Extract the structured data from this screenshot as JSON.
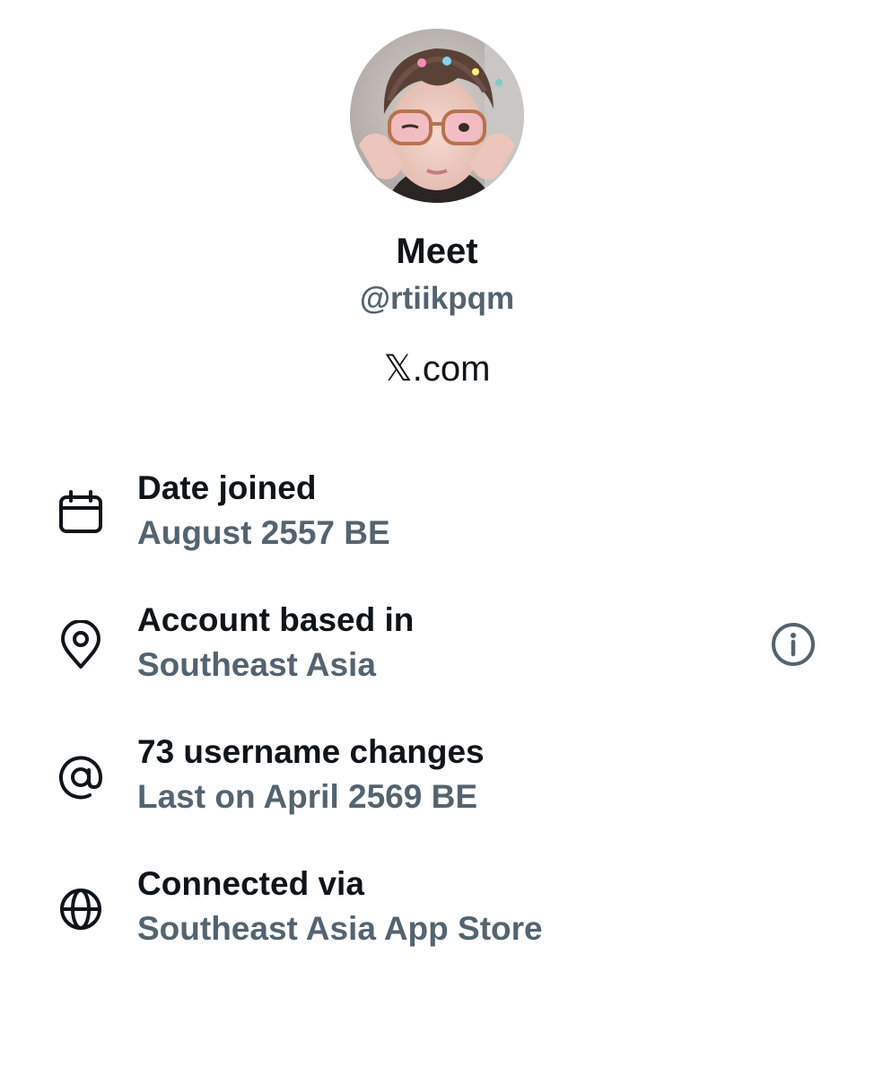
{
  "profile": {
    "display_name": "Meet",
    "handle": "@rtiikpqm",
    "site_suffix": ".com",
    "site_logo_glyph": "𝕏",
    "avatar_alt": "profile-photo"
  },
  "details": [
    {
      "icon": "calendar-icon",
      "title": "Date joined",
      "value": "August 2557 BE"
    },
    {
      "icon": "location-pin-icon",
      "title": "Account based in",
      "value": "Southeast Asia"
    },
    {
      "icon": "at-sign-icon",
      "title": "73 username changes",
      "value": "Last on April 2569 BE"
    },
    {
      "icon": "globe-icon",
      "title": "Connected via",
      "value": "Southeast Asia App Store"
    }
  ],
  "info_icon": "info-icon",
  "colors": {
    "primary_text": "#0f1419",
    "secondary_text": "#536471",
    "background": "#ffffff"
  }
}
